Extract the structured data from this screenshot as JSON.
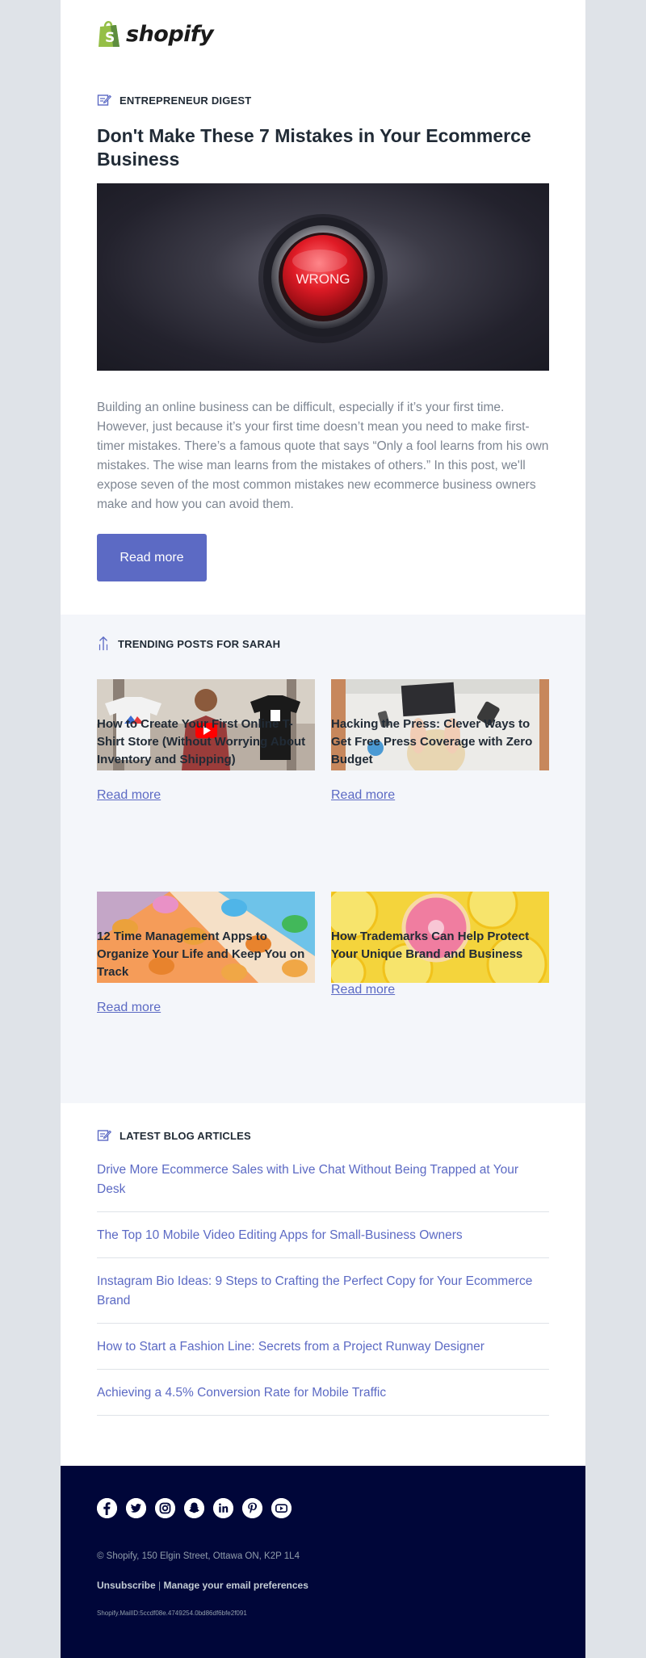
{
  "brand": {
    "name": "shopify",
    "accent": "#5c6ac4",
    "logo_green": "#95bf47"
  },
  "hero": {
    "section_label": "ENTREPRENEUR DIGEST",
    "title": "Don't Make These 7 Mistakes in Your Ecommerce Business",
    "image_button_text": "WRONG",
    "body": "Building an online business can be difficult, especially if it’s your first time. However, just because it’s your first time doesn’t mean you need to make first-timer mistakes. There’s a famous quote that says “Only a fool learns from his own mistakes. The wise man learns from the mistakes of others.” In this post, we'll expose seven of the most common mistakes new ecommerce business owners make and how you can avoid them.",
    "cta": "Read more"
  },
  "trending": {
    "section_label": "TRENDING POSTS FOR SARAH",
    "posts": [
      {
        "title": "How to Create Your First Online T-Shirt Store (Without Worrying About Inventory and Shipping)",
        "link": "Read more"
      },
      {
        "title": "Hacking the Press: Clever Ways to Get Free Press Coverage with Zero Budget",
        "link": "Read more"
      },
      {
        "title": "12 Time Management Apps to Organize Your Life and Keep You on Track",
        "link": "Read more"
      },
      {
        "title": "How Trademarks Can Help Protect Your Unique Brand and Business",
        "link": "Read more"
      }
    ]
  },
  "latest": {
    "section_label": "LATEST BLOG ARTICLES",
    "articles": [
      "Drive More Ecommerce Sales with Live Chat Without Being Trapped at Your Desk",
      "The Top 10 Mobile Video Editing Apps for Small-Business Owners",
      "Instagram Bio Ideas: 9 Steps to Crafting the Perfect Copy for Your Ecommerce Brand",
      "How to Start a Fashion Line: Secrets from a Project Runway Designer",
      "Achieving a 4.5% Conversion Rate for Mobile Traffic"
    ]
  },
  "footer": {
    "socials": [
      "facebook-icon",
      "twitter-icon",
      "instagram-icon",
      "snapchat-icon",
      "linkedin-icon",
      "pinterest-icon",
      "youtube-icon"
    ],
    "address": "© Shopify,  150 Elgin Street, Ottawa ON, K2P 1L4",
    "unsubscribe": "Unsubscribe",
    "separator": "|",
    "manage": "Manage your email preferences",
    "mail_id": "Shopify.MailID:5ccdf08e.4749254.0bd86df6bfe2f091"
  }
}
